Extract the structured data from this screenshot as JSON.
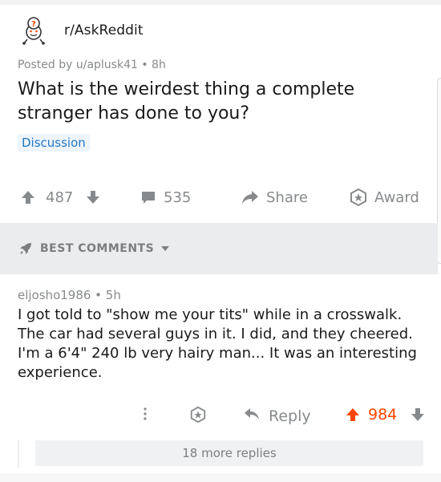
{
  "subreddit": {
    "name": "r/AskReddit",
    "icon": "askreddit-snoo-icon"
  },
  "post": {
    "meta": "Posted by u/aplusk41 • 8h",
    "title": "What is the weirdest thing a complete stranger has done to you?",
    "flair": "Discussion",
    "score": "487",
    "comment_count": "535",
    "share_label": "Share",
    "award_label": "Award"
  },
  "sort": {
    "label": "BEST COMMENTS"
  },
  "comment": {
    "meta": "eljosho1986 • 5h",
    "body": "I got told to \"show me your tits\" while in a crosswalk. The car had several guys in it. I did, and they cheered. I'm a 6'4\" 240 lb very hairy man... It was an interesting experience.",
    "reply_label": "Reply",
    "score": "984",
    "more_replies": "18 more replies"
  },
  "colors": {
    "upvote_active": "#ff4500",
    "flair_text": "#2476c4",
    "muted": "#878a8c"
  }
}
